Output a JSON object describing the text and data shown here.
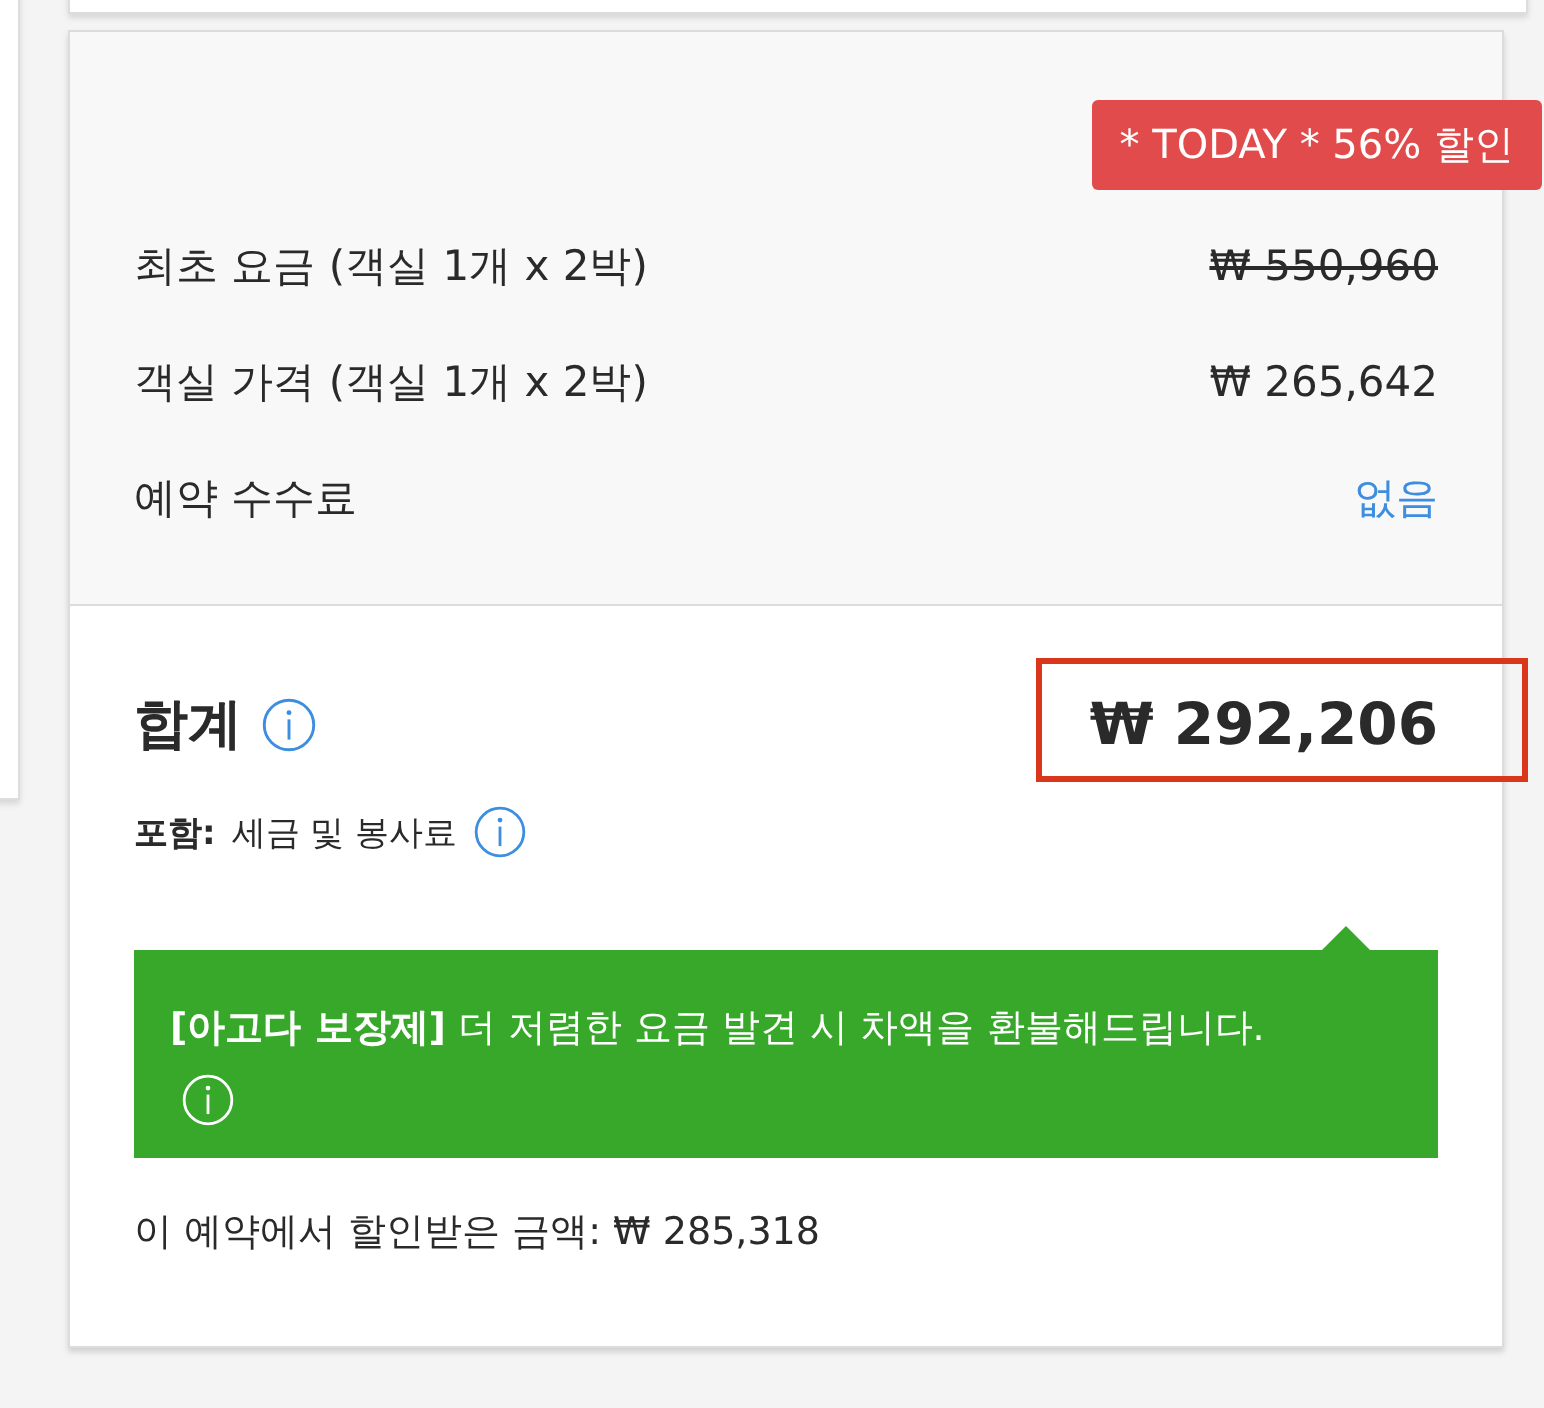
{
  "badge": "* TODAY * 56% 할인",
  "price_rows": [
    {
      "label": "최초 요금 (객실 1개 x 2박)",
      "value": "₩ 550,960",
      "struck": true,
      "kind": "amount"
    },
    {
      "label": "객실 가격 (객실 1개 x 2박)",
      "value": "₩ 265,642",
      "struck": false,
      "kind": "amount"
    },
    {
      "label": "예약 수수료",
      "value": "없음",
      "struck": false,
      "kind": "free"
    }
  ],
  "total": {
    "label": "합계",
    "value": "₩ 292,206",
    "highlighted": true
  },
  "includes": {
    "label": "포함:",
    "text": "세금 및 봉사료"
  },
  "guarantee": {
    "title": "[아고다 보장제]",
    "text": "더 저렴한 요금 발견 시 차액을 환불해드립니다."
  },
  "savings": "이 예약에서 할인받은 금액: ₩ 285,318"
}
